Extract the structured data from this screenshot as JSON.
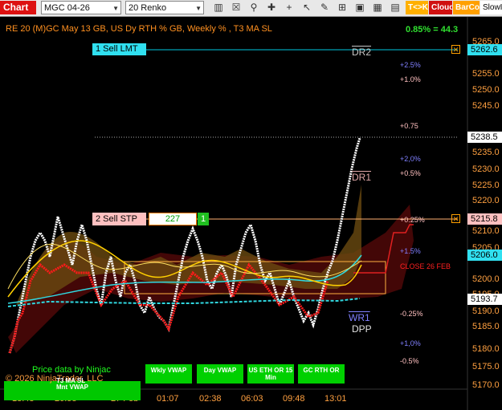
{
  "toolbar": {
    "title": "Chart",
    "instrument": "MGC 04-26",
    "period": "20 Renko",
    "buttons": [
      "T<>K",
      "Cloud",
      "BarCol",
      "SlowIn"
    ]
  },
  "header": {
    "indicator_label": "RE 20  (M)GC May 13 GB, US Dy RTH % GB, Weekly % , T3 MA SL",
    "change": "0.85% = 44.3"
  },
  "price_axis": [
    "5265.0",
    "5255.0",
    "5250.0",
    "5245.0",
    "5235.0",
    "5230.0",
    "5225.0",
    "5220.0",
    "5210.0",
    "5205.0",
    "5200.0",
    "5195.0",
    "5190.0",
    "5185.0",
    "5180.0",
    "5175.0",
    "5170.0"
  ],
  "price_tags": [
    {
      "label": "5262.6",
      "style": "cyan"
    },
    {
      "label": "5238.5",
      "style": "white"
    },
    {
      "label": "5215.8",
      "style": "pink"
    },
    {
      "label": "5206.0",
      "style": "cyan"
    },
    {
      "label": "5193.7",
      "style": "white"
    }
  ],
  "time_axis": [
    "18:43",
    "20:58",
    "27 Feb",
    "01:07",
    "02:38",
    "06:03",
    "09:48",
    "13:01"
  ],
  "orders": {
    "sell_lmt": "1 Sell LMT",
    "sell_stp": "2 Sell STP",
    "stp_ticks": "227",
    "stp_qty": "1"
  },
  "levels": {
    "dr2": "DR2",
    "dr1": "DR1",
    "wr1": "WR1",
    "dpp": "DPP",
    "close": "CLOSE 26 FEB",
    "percents": [
      "+2.5%",
      "+1.0%",
      "+0.75",
      "+2,0%",
      "+0.5%",
      "+0.25%",
      "+1.5%",
      "-0.25%",
      "+1,0%",
      "-0.5%"
    ]
  },
  "buttons": {
    "mnt_vwap": "Mnt VWAP",
    "t3_ma_sl": "T3 MA SL",
    "wkly_vwap": "Wkly VWAP",
    "day_vwap": "Day VWAP",
    "us_eth": "US ETH OR 15 Min",
    "gc_rth": "GC RTH OR"
  },
  "watermark": {
    "line1": "Price data by Ninjac",
    "line2": "© 2026 NinjaTrader, LLC"
  },
  "colors": {
    "cyan": "#00ffff",
    "pink": "#ffc0c0",
    "orange": "#ffa040",
    "green": "#00d000",
    "red": "#ff2020"
  }
}
